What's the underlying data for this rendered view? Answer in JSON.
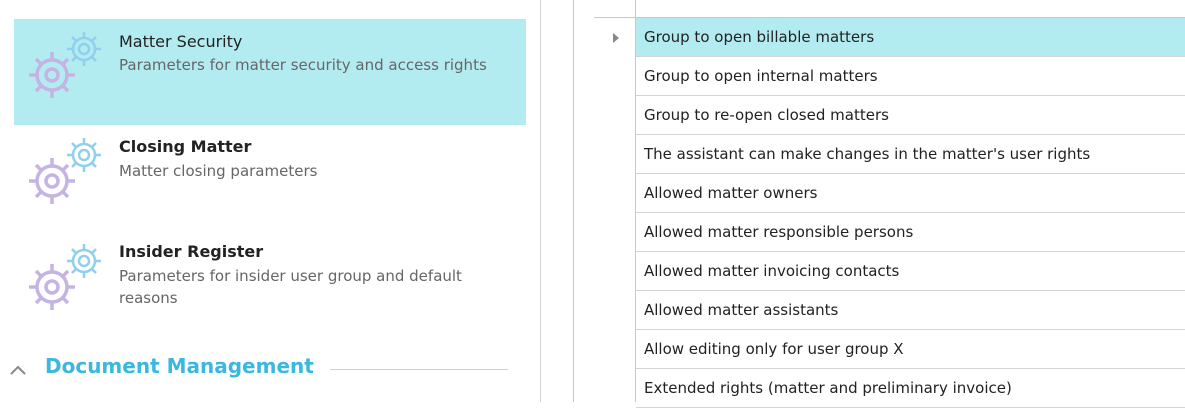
{
  "settings_list": {
    "items": [
      {
        "title": "Matter Security",
        "description": "Parameters for matter security and access rights",
        "selected": true,
        "bold": false
      },
      {
        "title": "Closing Matter",
        "description": "Matter closing parameters",
        "selected": false,
        "bold": true
      },
      {
        "title": "Insider Register",
        "description": "Parameters for insider user group and default reasons",
        "selected": false,
        "bold": true
      }
    ],
    "section": {
      "title": "Document Management",
      "expanded": true
    }
  },
  "grid": {
    "rows": [
      "Group to open billable matters",
      "Group to open internal matters",
      "Group to re-open closed matters",
      "The assistant can make changes in the matter's user rights",
      "Allowed matter owners",
      "Allowed matter responsible persons",
      "Allowed matter invoicing contacts",
      "Allowed matter assistants",
      "Allow editing only for user group X",
      "Extended rights (matter and preliminary invoice)"
    ],
    "current_row_index": 0
  },
  "colors": {
    "selection": "#b3ecf0",
    "accent": "#3bb8e0",
    "gear_small": "#8ed0ee",
    "gear_big": "#c5b4e3"
  },
  "icons": {
    "gear": "gear-icon",
    "chevron": "chevron-up-icon",
    "row_pointer": "row-pointer-icon"
  }
}
